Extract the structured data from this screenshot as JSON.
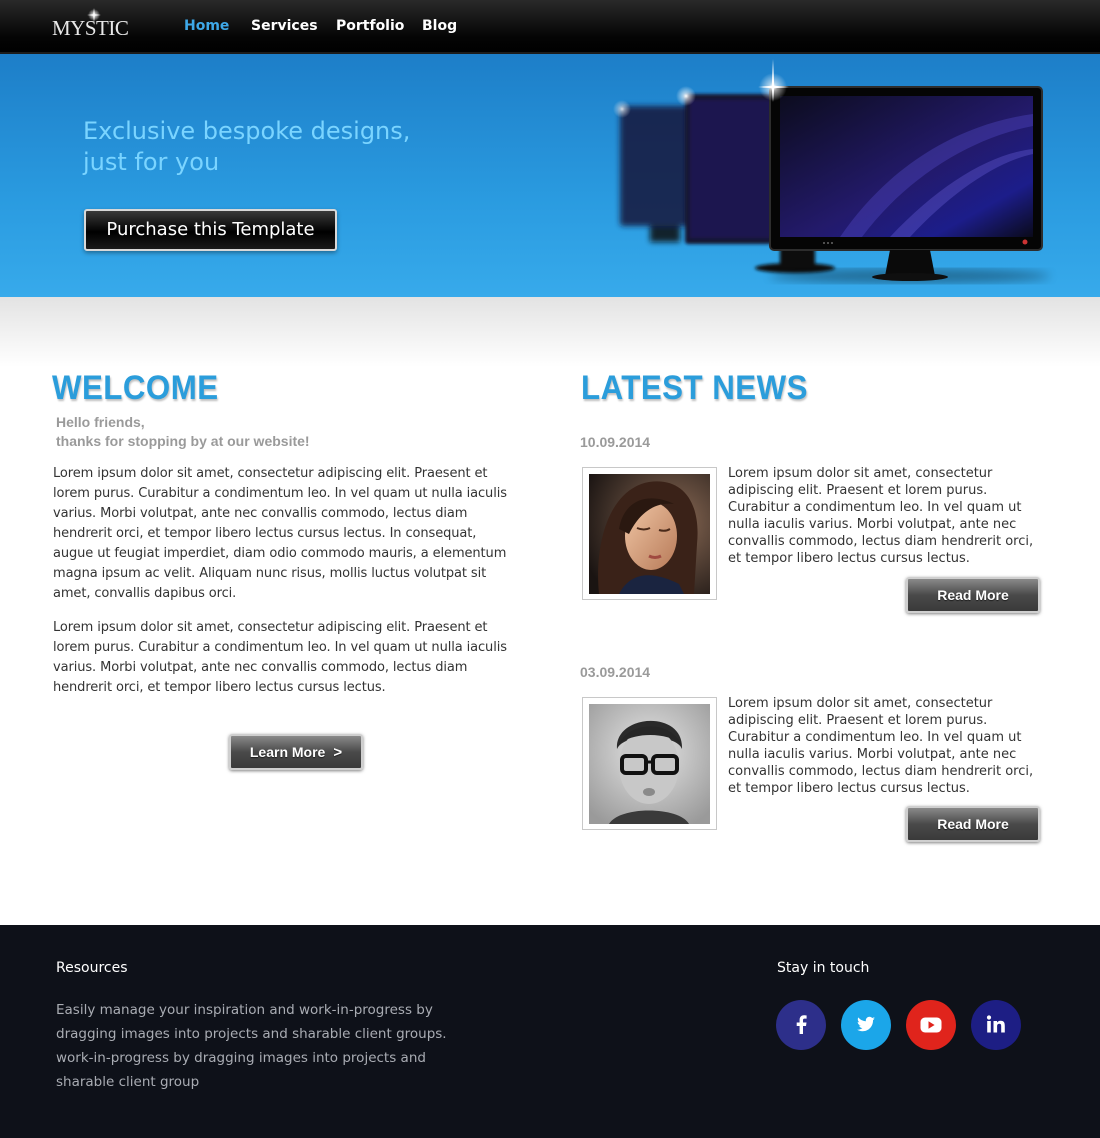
{
  "brand": {
    "logo_text": "MYSTIC"
  },
  "nav": {
    "items": [
      {
        "label": "Home",
        "active": true
      },
      {
        "label": "Services",
        "active": false
      },
      {
        "label": "Portfolio",
        "active": false
      },
      {
        "label": "Blog",
        "active": false
      }
    ]
  },
  "hero": {
    "title_line1": "Exclusive bespoke designs,",
    "title_line2": "just for you",
    "button_label": "Purchase this Template"
  },
  "welcome": {
    "heading": "WELCOME",
    "greeting_line1": "Hello friends,",
    "greeting_line2": "thanks for stopping by at our website!",
    "paragraph1": "Lorem ipsum dolor sit amet, consectetur adipiscing elit. Praesent et lorem purus. Curabitur a condimentum leo. In vel quam ut nulla iaculis varius. Morbi volutpat, ante nec convallis commodo, lectus diam hendrerit orci, et tempor libero lectus cursus lectus. In consequat, augue ut feugiat imperdiet, diam odio commodo mauris, a elementum magna ipsum ac velit. Aliquam nunc risus, mollis luctus volutpat sit amet, convallis dapibus orci.",
    "paragraph2": "Lorem ipsum dolor sit amet, consectetur adipiscing elit. Praesent et lorem purus. Curabitur a condimentum leo. In vel quam ut nulla iaculis varius. Morbi volutpat, ante nec convallis commodo, lectus diam hendrerit orci, et tempor libero lectus cursus lectus.",
    "button_label": "Learn More",
    "button_arrow": ">"
  },
  "news": {
    "heading": "LATEST NEWS",
    "items": [
      {
        "date": "10.09.2014",
        "text": "Lorem ipsum dolor sit amet, consectetur adipiscing elit. Praesent et lorem purus. Curabitur a condimentum leo. In vel quam ut nulla iaculis varius. Morbi volutpat, ante nec convallis commodo, lectus diam hendrerit orci, et tempor libero lectus cursus lectus.",
        "button_label": "Read More",
        "image": "woman-portrait"
      },
      {
        "date": "03.09.2014",
        "text": "Lorem ipsum dolor sit amet, consectetur adipiscing elit. Praesent et lorem purus. Curabitur a condimentum leo. In vel quam ut nulla iaculis varius. Morbi volutpat, ante nec convallis commodo, lectus diam hendrerit orci, et tempor libero lectus cursus lectus.",
        "button_label": "Read More",
        "image": "man-with-glasses-portrait"
      }
    ]
  },
  "footer": {
    "resources_title": "Resources",
    "resources_text": "Easily manage your inspiration and work-in-progress by dragging images into projects and sharable client groups. work-in-progress by dragging images into projects and sharable client group",
    "touch_title": "Stay in touch",
    "social": [
      {
        "icon": "facebook-icon",
        "color": "#2d2f8a"
      },
      {
        "icon": "twitter-icon",
        "color": "#1ba6e9"
      },
      {
        "icon": "youtube-icon",
        "color": "#e0241c"
      },
      {
        "icon": "linkedin-icon",
        "color": "#1d1e84"
      }
    ]
  },
  "colors": {
    "accent_blue": "#2b9ddb",
    "hero_text": "#7ad4ff",
    "footer_bg": "#0e1119"
  }
}
